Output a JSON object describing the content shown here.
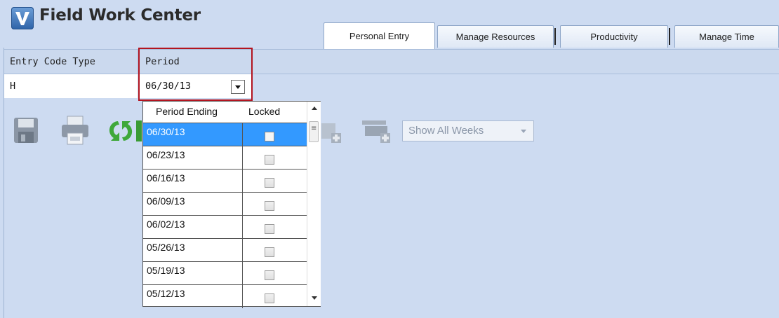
{
  "app": {
    "title": "Field Work Center"
  },
  "tabs": [
    {
      "label": "Personal Entry",
      "active": true
    },
    {
      "label": "Manage Resources",
      "active": false
    },
    {
      "label": "Productivity",
      "active": false
    },
    {
      "label": "Manage Time",
      "active": false
    }
  ],
  "grid": {
    "headers": {
      "entry_code_type": "Entry Code Type",
      "period": "Period"
    },
    "values": {
      "entry_code_type": "H",
      "period": "06/30/13"
    }
  },
  "toolbar": {
    "icons": [
      "save-icon",
      "print-icon",
      "refresh-icon",
      "add-row-icon",
      "add-rows-icon"
    ],
    "week_filter": {
      "selected": "Show All Weeks"
    }
  },
  "period_dropdown": {
    "columns": {
      "period_ending": "Period Ending",
      "locked": "Locked"
    },
    "rows": [
      {
        "date": "06/30/13",
        "locked": false,
        "selected": true
      },
      {
        "date": "06/23/13",
        "locked": false,
        "selected": false
      },
      {
        "date": "06/16/13",
        "locked": false,
        "selected": false
      },
      {
        "date": "06/09/13",
        "locked": false,
        "selected": false
      },
      {
        "date": "06/02/13",
        "locked": false,
        "selected": false
      },
      {
        "date": "05/26/13",
        "locked": false,
        "selected": false
      },
      {
        "date": "05/19/13",
        "locked": false,
        "selected": false
      },
      {
        "date": "05/12/13",
        "locked": false,
        "selected": false
      }
    ]
  },
  "colors": {
    "selection": "#3399ff",
    "highlight_border": "#b3141f",
    "background": "#cddbf1"
  }
}
